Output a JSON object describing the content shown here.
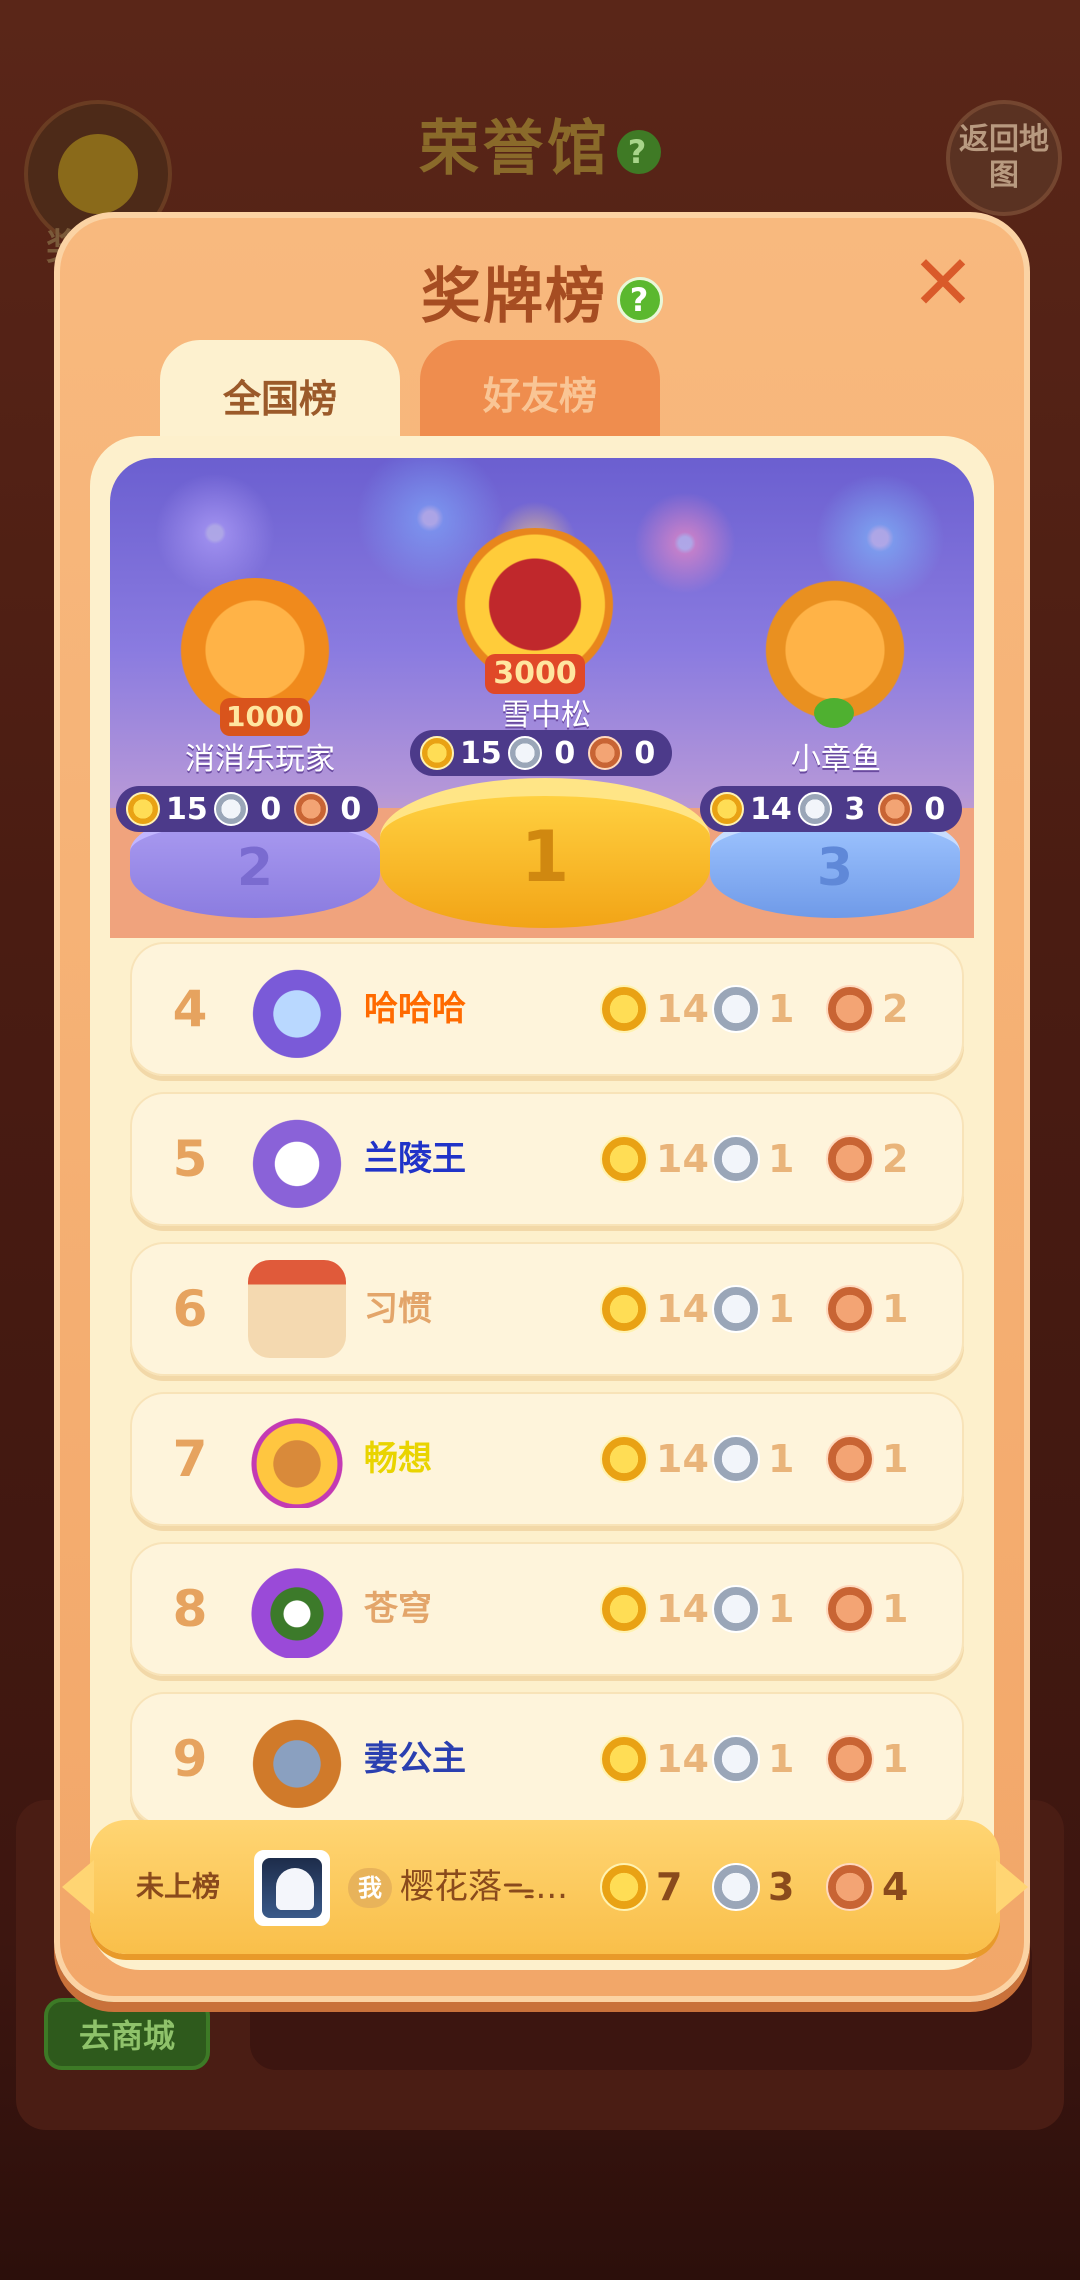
{
  "background": {
    "title": "荣誉馆",
    "title_help": "?",
    "left_label": "奖",
    "back_button": "返回地图",
    "shop_button": "去商城"
  },
  "modal": {
    "title": "奖牌榜",
    "help": "?",
    "close": "✕",
    "tabs": [
      {
        "label": "全国榜",
        "selected": true
      },
      {
        "label": "好友榜",
        "selected": false
      }
    ]
  },
  "podium": [
    {
      "rank": "2",
      "name": "消消乐玩家",
      "badge": "1000",
      "gold": "15",
      "silver": "0",
      "bronze": "0"
    },
    {
      "rank": "1",
      "name": "雪中松",
      "badge": "3000",
      "gold": "15",
      "silver": "0",
      "bronze": "0"
    },
    {
      "rank": "3",
      "name": "小章鱼",
      "gold": "14",
      "silver": "3",
      "bronze": "0"
    }
  ],
  "rows": [
    {
      "rank": "4",
      "name": "哈哈哈",
      "name_color": "#ff6a00",
      "gold": "14",
      "silver": "1",
      "bronze": "2"
    },
    {
      "rank": "5",
      "name": "兰陵王",
      "name_color": "#2033c8",
      "gold": "14",
      "silver": "1",
      "bronze": "2"
    },
    {
      "rank": "6",
      "name": "习惯",
      "name_color": "#e3a56a",
      "gold": "14",
      "silver": "1",
      "bronze": "1"
    },
    {
      "rank": "7",
      "name": "畅想",
      "name_color": "#e9d400",
      "gold": "14",
      "silver": "1",
      "bronze": "1"
    },
    {
      "rank": "8",
      "name": "苍穹",
      "name_color": "#e3a56a",
      "gold": "14",
      "silver": "1",
      "bronze": "1"
    },
    {
      "rank": "9",
      "name": "妻公主",
      "name_color": "#2a3fb0",
      "gold": "14",
      "silver": "1",
      "bronze": "1"
    }
  ],
  "me": {
    "status": "未上榜",
    "tag": "我",
    "name": "樱花落ᯓ...",
    "gold": "7",
    "silver": "3",
    "bronze": "4"
  }
}
